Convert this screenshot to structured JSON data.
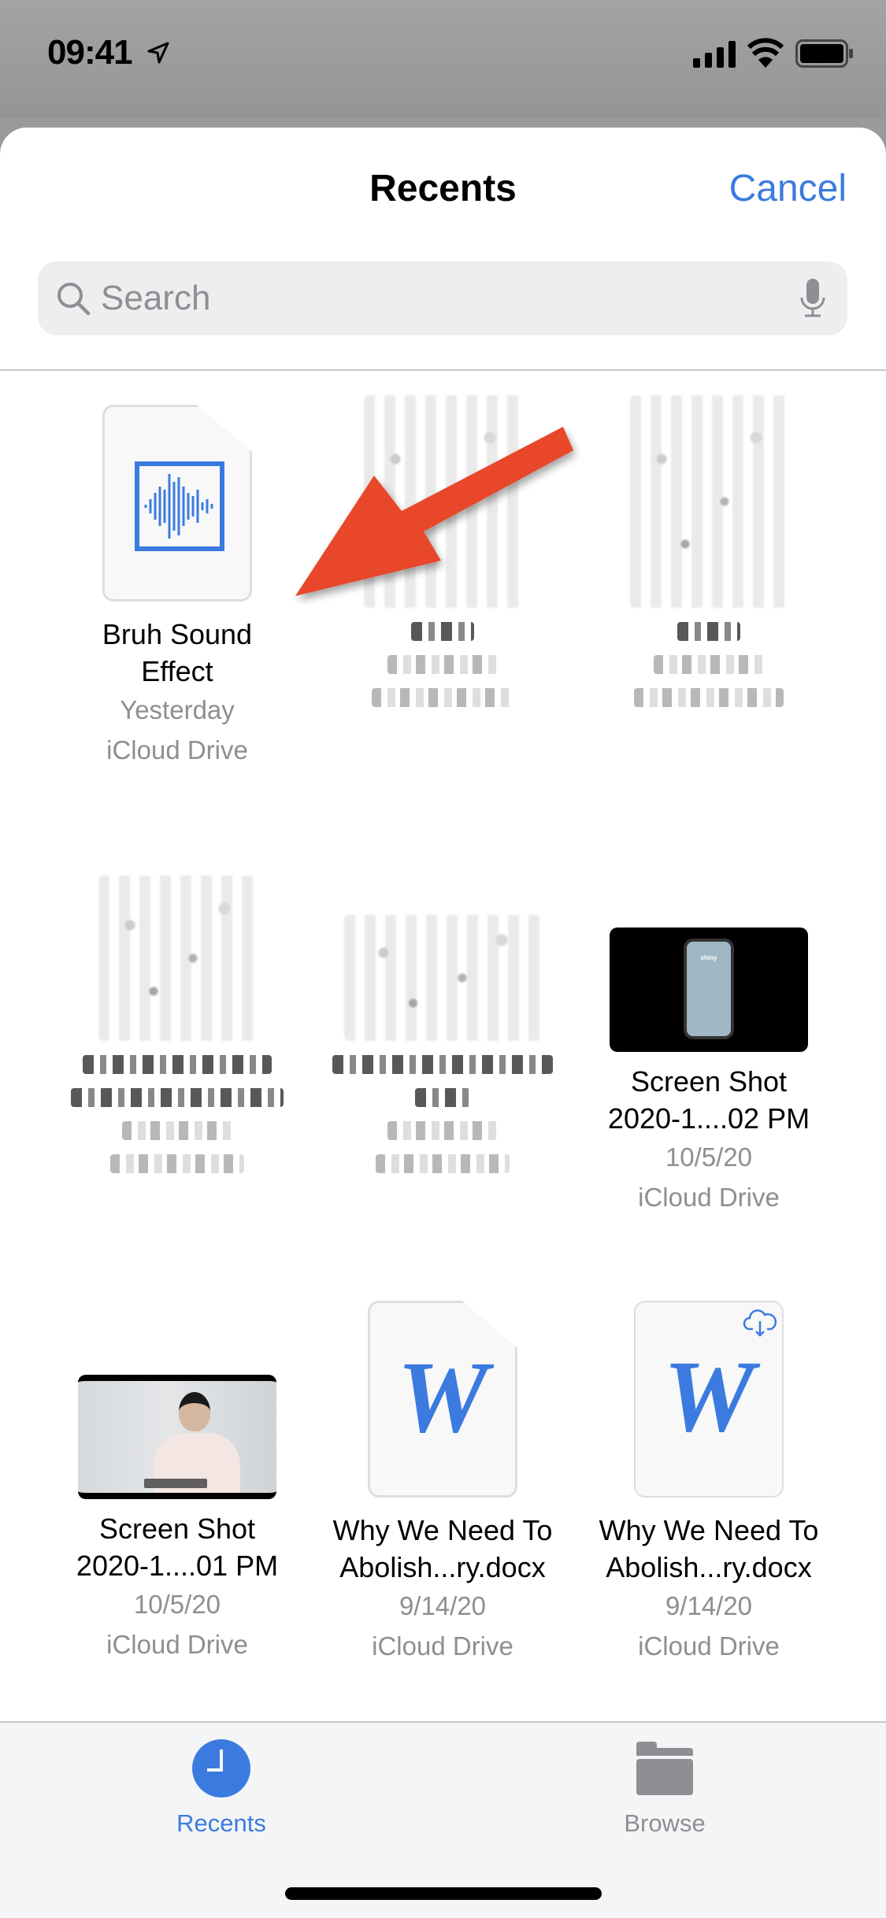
{
  "status_bar": {
    "time": "09:41",
    "icons": [
      "location-arrow-icon",
      "cellular-signal-icon",
      "wifi-icon",
      "battery-icon"
    ]
  },
  "header": {
    "title": "Recents",
    "cancel_label": "Cancel"
  },
  "search": {
    "placeholder": "Search",
    "value": "",
    "icons": [
      "search-icon",
      "microphone-icon"
    ]
  },
  "colors": {
    "accent": "#3b7be0",
    "secondary_text": "#8e8e93",
    "annotation_arrow": "#e8472a"
  },
  "files": [
    {
      "name_line1": "Bruh Sound",
      "name_line2": "Effect",
      "date": "Yesterday",
      "location": "iCloud Drive",
      "type": "audio",
      "icon": "audio-waveform-icon"
    },
    {
      "redacted": true,
      "type": "unknown"
    },
    {
      "redacted": true,
      "type": "unknown"
    },
    {
      "redacted": true,
      "type": "unknown"
    },
    {
      "redacted": true,
      "type": "unknown"
    },
    {
      "name_line1": "Screen Shot",
      "name_line2": "2020-1....02 PM",
      "date": "10/5/20",
      "location": "iCloud Drive",
      "type": "image",
      "thumb_label": "shiny"
    },
    {
      "name_line1": "Screen Shot",
      "name_line2": "2020-1....01 PM",
      "date": "10/5/20",
      "location": "iCloud Drive",
      "type": "image"
    },
    {
      "name_line1": "Why We Need To",
      "name_line2": "Abolish...ry.docx",
      "date": "9/14/20",
      "location": "iCloud Drive",
      "type": "word",
      "icon_letter": "W"
    },
    {
      "name_line1": "Why We Need To",
      "name_line2": "Abolish...ry.docx",
      "date": "9/14/20",
      "location": "iCloud Drive",
      "type": "word",
      "icon_letter": "W",
      "cloud_download": true
    }
  ],
  "tab_bar": {
    "tabs": [
      {
        "label": "Recents",
        "icon": "clock-icon",
        "selected": true
      },
      {
        "label": "Browse",
        "icon": "folder-icon",
        "selected": false
      }
    ]
  }
}
